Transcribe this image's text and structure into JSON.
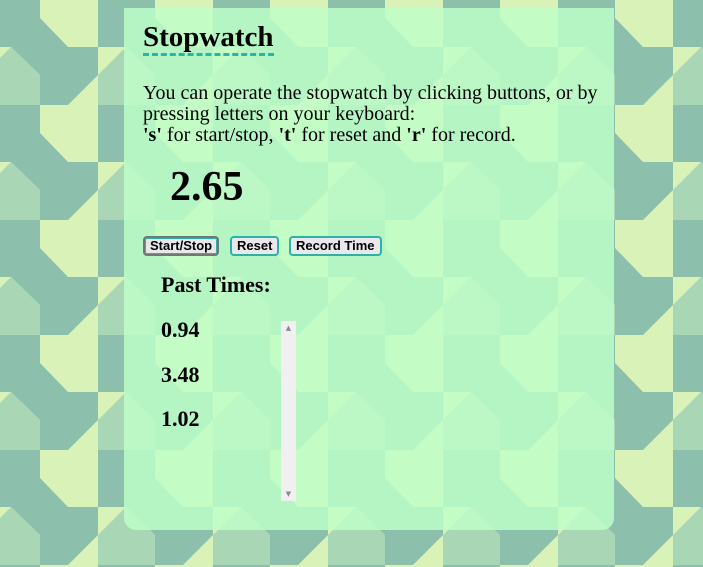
{
  "title": "Stopwatch",
  "instructions": {
    "line1": "You can operate the stopwatch by clicking buttons, or by pressing letters on your keyboard:",
    "key_s": "'s'",
    "text_s": " for start/stop, ",
    "key_t": "'t'",
    "text_t": " for reset and ",
    "key_r": "'r'",
    "text_r": " for record."
  },
  "time": "2.65",
  "buttons": {
    "start_stop": "Start/Stop",
    "reset": "Reset",
    "record": "Record Time"
  },
  "past_times": {
    "title": "Past Times:",
    "items": [
      "0.94",
      "3.48",
      "1.02"
    ]
  },
  "scrollbar": {
    "up_icon": "▲",
    "down_icon": "▼"
  },
  "colors": {
    "panel": "#c0ffc8",
    "accent": "#2bb3a7",
    "bg_light": "#d8f2b8",
    "bg_dark": "#8cc0ac"
  }
}
